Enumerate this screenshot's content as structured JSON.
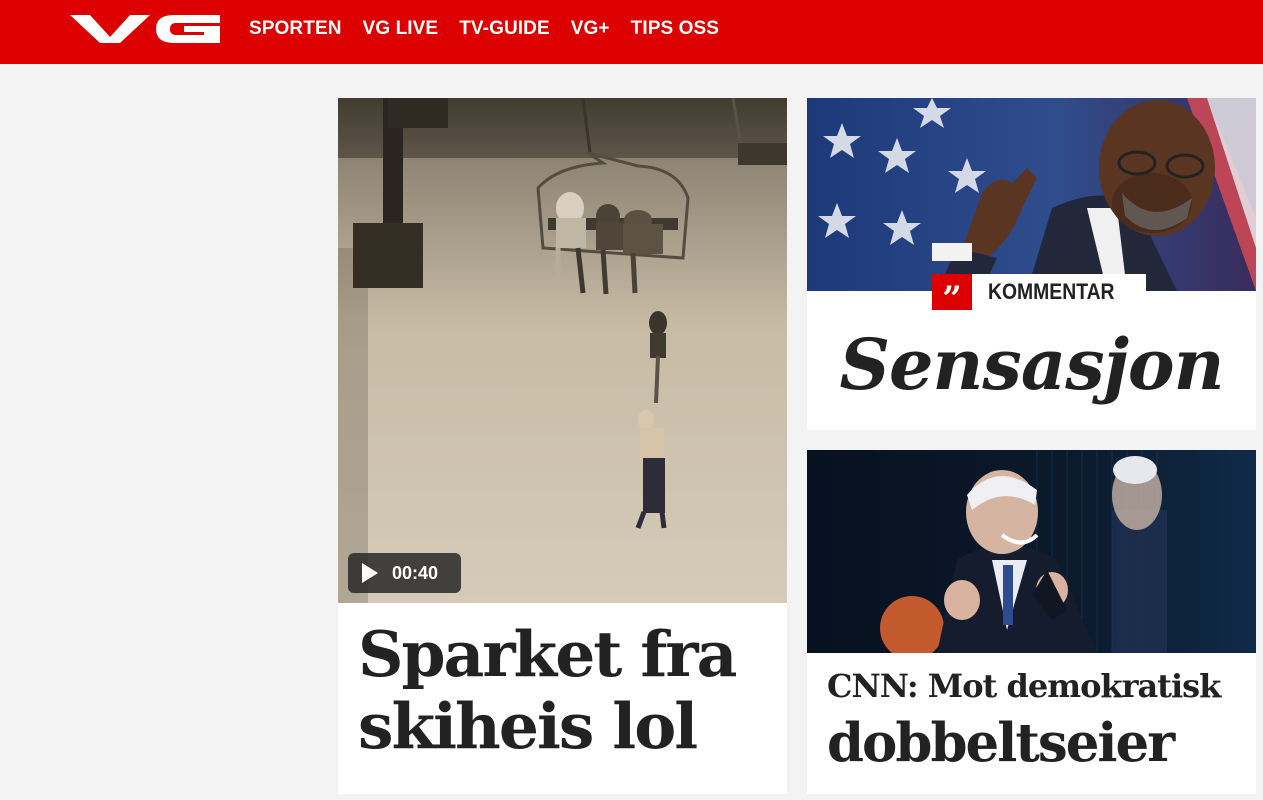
{
  "header": {
    "logo_text": "VG",
    "nav": [
      "SPORTEN",
      "VG LIVE",
      "TV-GUIDE",
      "VG+",
      "TIPS OSS"
    ],
    "brand_color": "#dd0000"
  },
  "main_story": {
    "video_duration": "00:40",
    "headline_line1": "Sparket fra",
    "headline_line2": "skiheis lol"
  },
  "comment_story": {
    "label": "KOMMENTAR",
    "quote_icon": "quote-icon",
    "quote_mark": "”",
    "headline": "Sensasjon"
  },
  "cnn_story": {
    "headline_line1": "CNN: Mot demokratisk",
    "headline_line2": "dobbeltseier"
  }
}
